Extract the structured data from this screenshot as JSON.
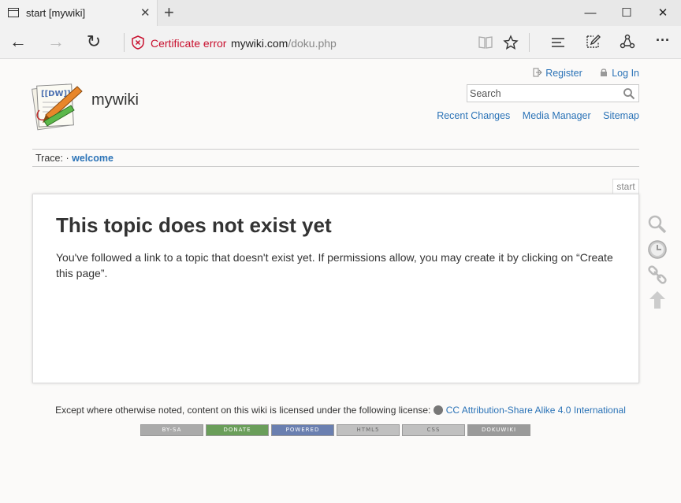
{
  "browser": {
    "tab_title": "start [mywiki]",
    "tab_close": "✕",
    "new_tab": "+",
    "minimize": "—",
    "maximize": "☐",
    "close": "✕",
    "back": "←",
    "forward": "→",
    "refresh": "↻",
    "cert_error": "Certificate error",
    "url_domain": "mywiki.com",
    "url_path": "/doku.php",
    "more": "···"
  },
  "usertools": {
    "register": "Register",
    "login": "Log In"
  },
  "site": {
    "name": "mywiki"
  },
  "search": {
    "placeholder": "Search"
  },
  "sitetools": {
    "recent": "Recent Changes",
    "media": "Media Manager",
    "sitemap": "Sitemap"
  },
  "trace": {
    "label": "Trace:",
    "sep": "·",
    "link": "welcome"
  },
  "page": {
    "tab": "start",
    "heading": "This topic does not exist yet",
    "body": "You've followed a link to a topic that doesn't exist yet. If permissions allow, you may create it by clicking on “Create this page”."
  },
  "footer": {
    "text": "Except where otherwise noted, content on this wiki is licensed under the following license:",
    "license": "CC Attribution-Share Alike 4.0 International",
    "badges": [
      "BY-SA",
      "DONATE",
      "POWERED",
      "HTML5",
      "CSS",
      "DOKUWIKI"
    ]
  }
}
